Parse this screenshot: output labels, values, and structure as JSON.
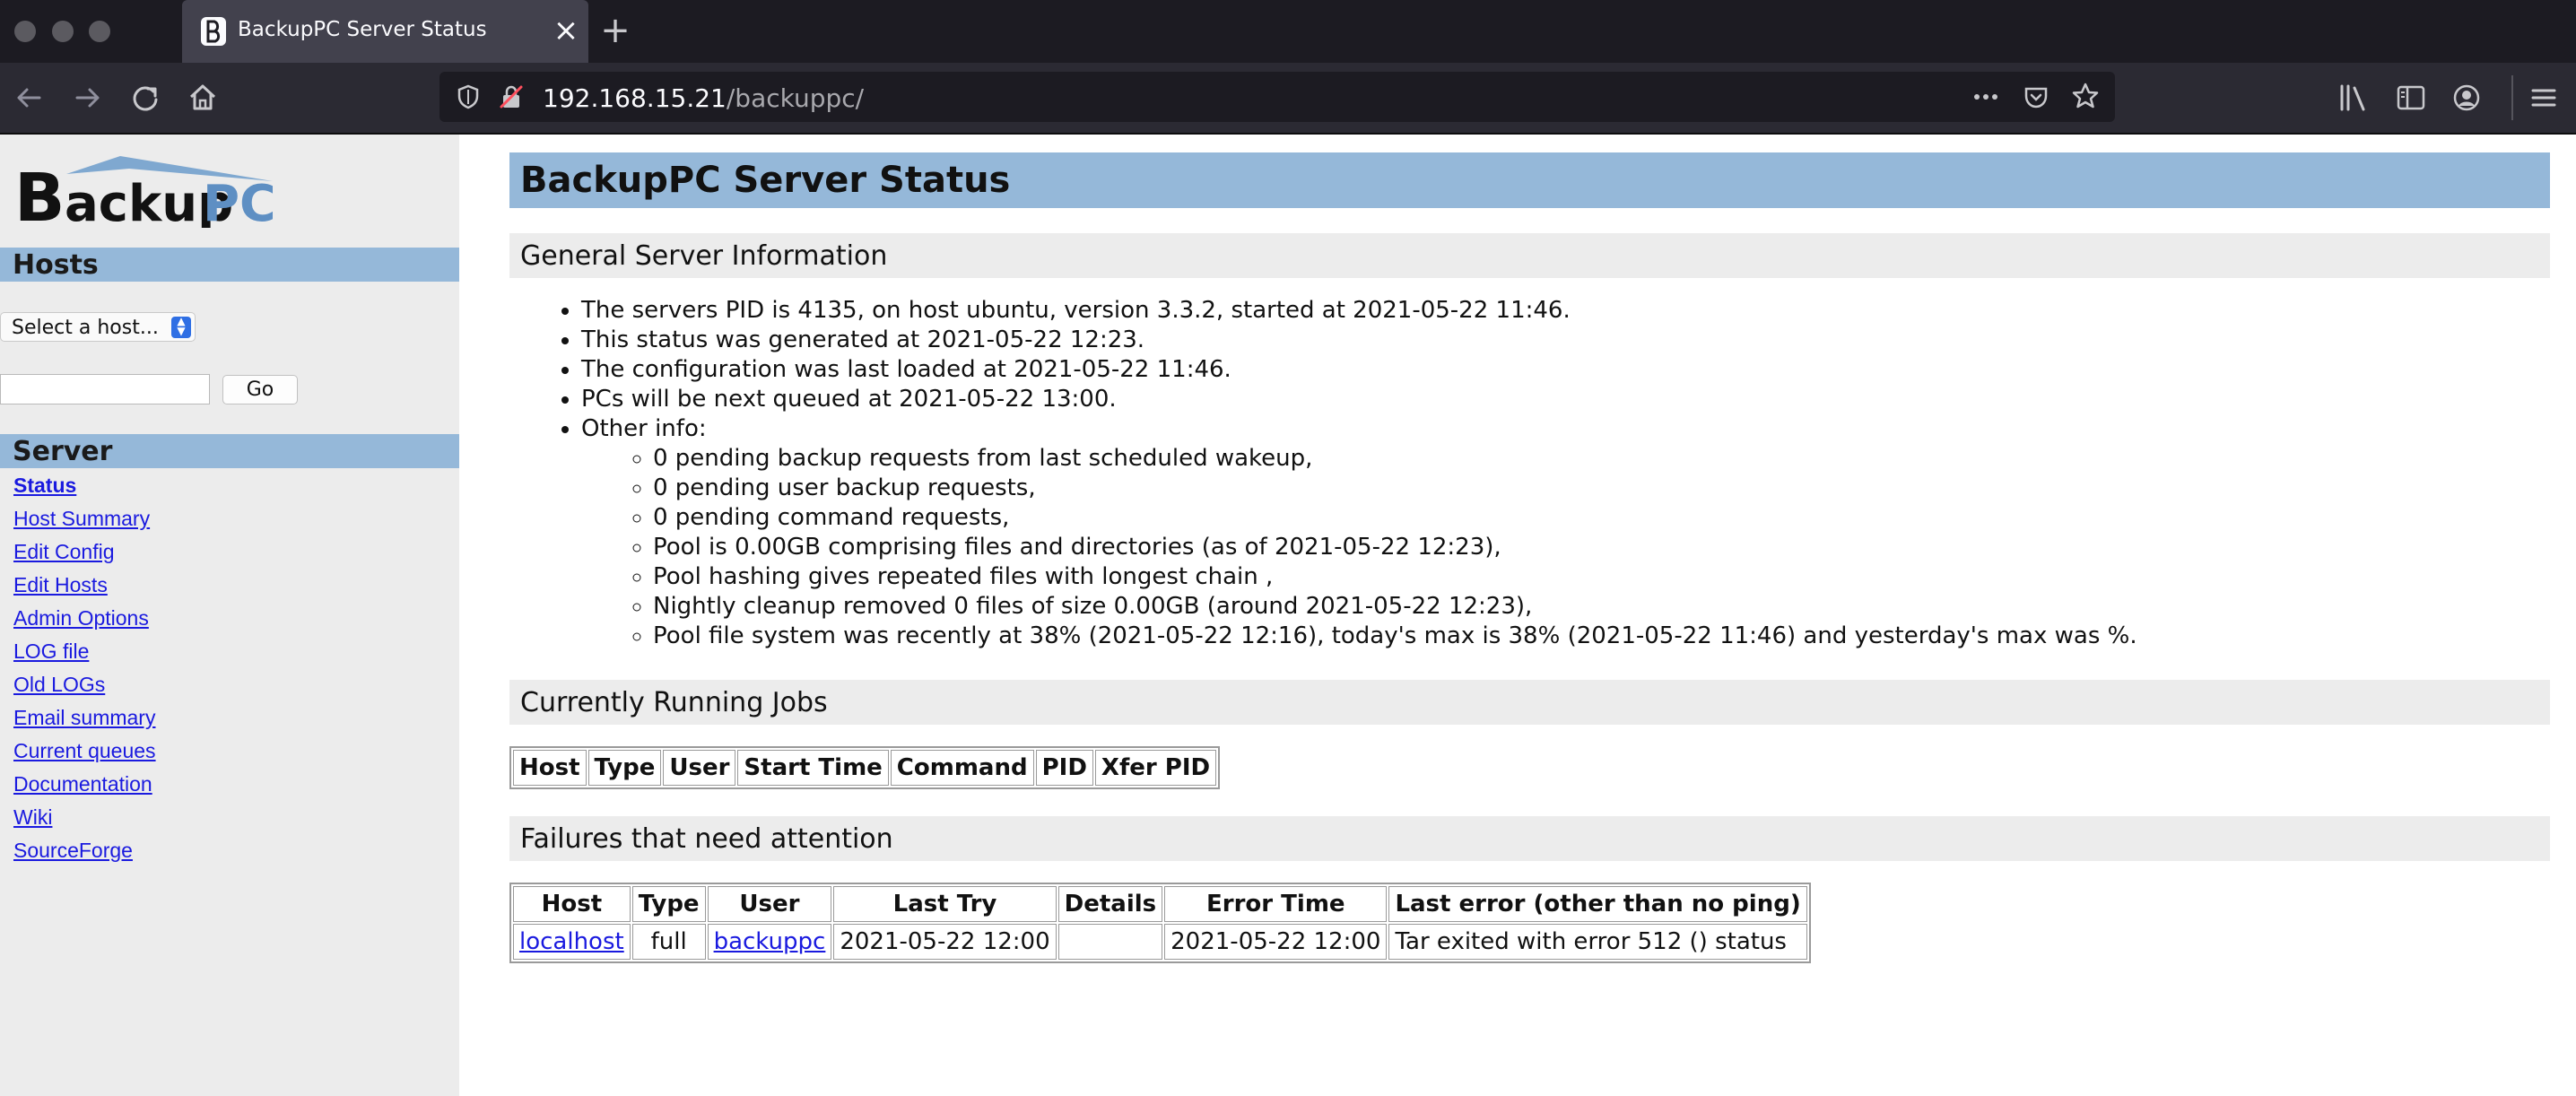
{
  "browser": {
    "tab_title": "BackupPC Server Status",
    "url_host": "192.168.15.21",
    "url_path": "/backuppc/"
  },
  "sidebar": {
    "logo_text": "BackupPC",
    "hosts_heading": "Hosts",
    "host_select_value": "Select a host...",
    "go_label": "Go",
    "server_heading": "Server",
    "links": [
      {
        "label": "Status",
        "active": true
      },
      {
        "label": "Host Summary"
      },
      {
        "label": "Edit Config"
      },
      {
        "label": "Edit Hosts"
      },
      {
        "label": "Admin Options"
      },
      {
        "label": "LOG file"
      },
      {
        "label": "Old LOGs"
      },
      {
        "label": "Email summary"
      },
      {
        "label": "Current queues"
      },
      {
        "label": "Documentation"
      },
      {
        "label": "Wiki"
      },
      {
        "label": "SourceForge"
      }
    ]
  },
  "main": {
    "title": "BackupPC Server Status",
    "general_heading": "General Server Information",
    "info": [
      "The servers PID is 4135, on host ubuntu, version 3.3.2, started at 2021-05-22 11:46.",
      "This status was generated at 2021-05-22 12:23.",
      "The configuration was last loaded at 2021-05-22 11:46.",
      "PCs will be next queued at 2021-05-22 13:00.",
      "Other info:"
    ],
    "other_info": [
      "0 pending backup requests from last scheduled wakeup,",
      "0 pending user backup requests,",
      "0 pending command requests,",
      "Pool is 0.00GB comprising files and directories (as of 2021-05-22 12:23),",
      "Pool hashing gives repeated files with longest chain ,",
      "Nightly cleanup removed 0 files of size 0.00GB (around 2021-05-22 12:23),",
      "Pool file system was recently at 38% (2021-05-22 12:16), today's max is 38% (2021-05-22 11:46) and yesterday's max was %."
    ],
    "running_heading": "Currently Running Jobs",
    "running_columns": [
      "Host",
      "Type",
      "User",
      "Start Time",
      "Command",
      "PID",
      "Xfer PID"
    ],
    "failures_heading": "Failures that need attention",
    "failures_columns": [
      "Host",
      "Type",
      "User",
      "Last Try",
      "Details",
      "Error Time",
      "Last error (other than no ping)"
    ],
    "failures_rows": [
      {
        "host": "localhost",
        "type": "full",
        "user": "backuppc",
        "last_try": "2021-05-22 12:00",
        "details": "",
        "error_time": "2021-05-22 12:00",
        "last_error": "Tar exited with error 512 () status"
      }
    ]
  }
}
